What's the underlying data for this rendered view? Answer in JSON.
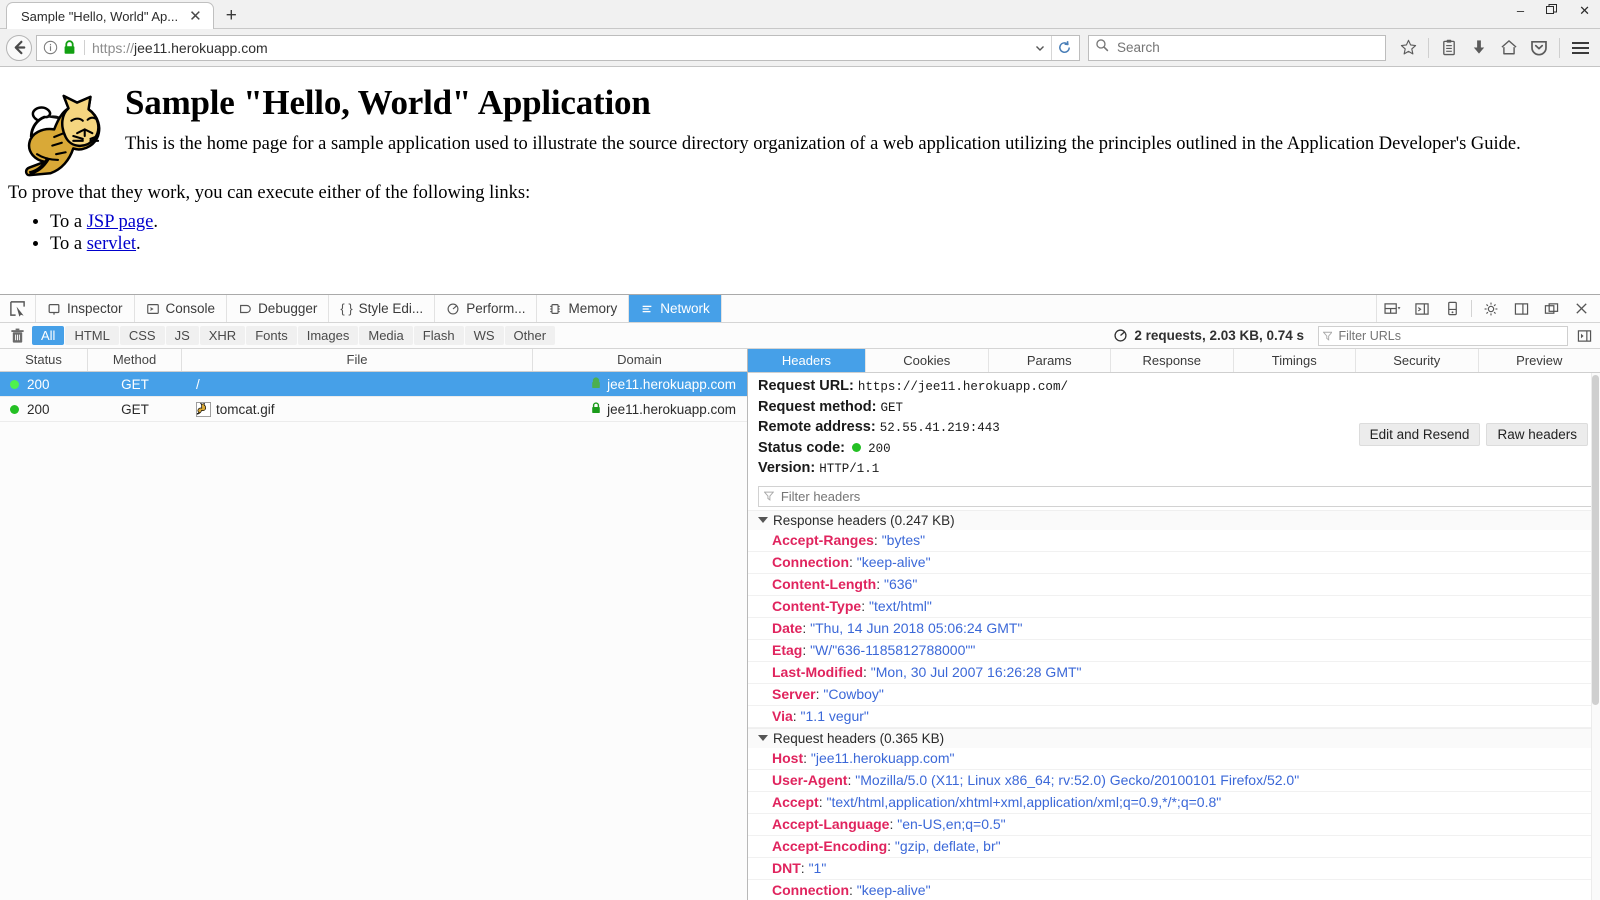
{
  "browser": {
    "tab": {
      "title": "Sample \"Hello, World\" Ap...",
      "close_label": "✕"
    },
    "newtab_label": "+",
    "window_controls": {
      "minimize": "–",
      "maximize": "❐",
      "close": "✕"
    },
    "url": {
      "scheme": "https://",
      "host": "jee11.herokuapp.com"
    },
    "search_placeholder": "Search",
    "icons": {
      "back": "back-arrow-icon",
      "identity": "info-icon",
      "lock": "lock-icon",
      "dropmarker": "chevron-down-icon",
      "reload": "reload-icon",
      "search": "search-icon",
      "bookmark": "star-icon",
      "library": "library-icon",
      "downloads": "download-icon",
      "home": "home-icon",
      "pocket": "pocket-icon",
      "menu": "hamburger-menu-icon"
    }
  },
  "page": {
    "title": "Sample \"Hello, World\" Application",
    "intro": "This is the home page for a sample application used to illustrate the source directory organization of a web application utilizing the principles outlined in the Application Developer's Guide.",
    "prove": "To prove that they work, you can execute either of the following links:",
    "links": [
      {
        "prefix": "To a ",
        "link": "JSP page",
        "suffix": "."
      },
      {
        "prefix": "To a ",
        "link": "servlet",
        "suffix": "."
      }
    ],
    "logo_alt": "tomcat-logo"
  },
  "devtools": {
    "tabs": [
      {
        "label": "Inspector",
        "icon": "inspector-icon",
        "active": false
      },
      {
        "label": "Console",
        "icon": "console-icon",
        "active": false
      },
      {
        "label": "Debugger",
        "icon": "debugger-icon",
        "active": false
      },
      {
        "label": "Style Edi...",
        "icon": "style-editor-icon",
        "active": false
      },
      {
        "label": "Perform...",
        "icon": "performance-icon",
        "active": false
      },
      {
        "label": "Memory",
        "icon": "memory-icon",
        "active": false
      },
      {
        "label": "Network",
        "icon": "network-icon",
        "active": true
      }
    ],
    "right_icons": [
      "split-console-layout-icon",
      "open-console-icon",
      "responsive-design-icon",
      "settings-gear-icon",
      "dock-side-icon",
      "separate-window-icon",
      "close-icon"
    ],
    "filters": [
      {
        "label": "All",
        "active": true
      },
      {
        "label": "HTML",
        "active": false
      },
      {
        "label": "CSS",
        "active": false
      },
      {
        "label": "JS",
        "active": false
      },
      {
        "label": "XHR",
        "active": false
      },
      {
        "label": "Fonts",
        "active": false
      },
      {
        "label": "Images",
        "active": false
      },
      {
        "label": "Media",
        "active": false
      },
      {
        "label": "Flash",
        "active": false
      },
      {
        "label": "WS",
        "active": false
      },
      {
        "label": "Other",
        "active": false
      }
    ],
    "summary": "2 requests, 2.03 KB, 0.74 s",
    "url_filter_placeholder": "Filter URLs",
    "trash_icon": "trash-icon",
    "network_table": {
      "columns": [
        "Status",
        "Method",
        "File",
        "Domain"
      ],
      "rows": [
        {
          "status": "200",
          "method": "GET",
          "file": "/",
          "domain": "jee11.herokuapp.com",
          "selected": true,
          "has_favicon": false
        },
        {
          "status": "200",
          "method": "GET",
          "file": "tomcat.gif",
          "domain": "jee11.herokuapp.com",
          "selected": false,
          "has_favicon": true
        }
      ]
    },
    "detail_tabs": [
      {
        "label": "Headers",
        "active": true
      },
      {
        "label": "Cookies",
        "active": false
      },
      {
        "label": "Params",
        "active": false
      },
      {
        "label": "Response",
        "active": false
      },
      {
        "label": "Timings",
        "active": false
      },
      {
        "label": "Security",
        "active": false
      },
      {
        "label": "Preview",
        "active": false
      }
    ],
    "summary_fields": {
      "request_url_label": "Request URL:",
      "request_url_value": "https://jee11.herokuapp.com/",
      "request_method_label": "Request method:",
      "request_method_value": "GET",
      "remote_address_label": "Remote address:",
      "remote_address_value": "52.55.41.219:443",
      "status_code_label": "Status code:",
      "status_code_value": "200",
      "version_label": "Version:",
      "version_value": "HTTP/1.1"
    },
    "edit_resend_label": "Edit and Resend",
    "raw_headers_label": "Raw headers",
    "header_filter_placeholder": "Filter headers",
    "response_headers_title": "Response headers (0.247 KB)",
    "response_headers": [
      {
        "name": "Accept-Ranges",
        "value": "\"bytes\""
      },
      {
        "name": "Connection",
        "value": "\"keep-alive\""
      },
      {
        "name": "Content-Length",
        "value": "\"636\""
      },
      {
        "name": "Content-Type",
        "value": "\"text/html\""
      },
      {
        "name": "Date",
        "value": "\"Thu, 14 Jun 2018 05:06:24 GMT\""
      },
      {
        "name": "Etag",
        "value": "\"W/\"636-1185812788000\"\""
      },
      {
        "name": "Last-Modified",
        "value": "\"Mon, 30 Jul 2007 16:26:28 GMT\""
      },
      {
        "name": "Server",
        "value": "\"Cowboy\""
      },
      {
        "name": "Via",
        "value": "\"1.1 vegur\""
      }
    ],
    "request_headers_title": "Request headers (0.365 KB)",
    "request_headers": [
      {
        "name": "Host",
        "value": "\"jee11.herokuapp.com\""
      },
      {
        "name": "User-Agent",
        "value": "\"Mozilla/5.0 (X11; Linux x86_64; rv:52.0) Gecko/20100101 Firefox/52.0\""
      },
      {
        "name": "Accept",
        "value": "\"text/html,application/xhtml+xml,application/xml;q=0.9,*/*;q=0.8\""
      },
      {
        "name": "Accept-Language",
        "value": "\"en-US,en;q=0.5\""
      },
      {
        "name": "Accept-Encoding",
        "value": "\"gzip, deflate, br\""
      },
      {
        "name": "DNT",
        "value": "\"1\""
      },
      {
        "name": "Connection",
        "value": "\"keep-alive\""
      }
    ]
  },
  "colors": {
    "accent_blue": "#46a0e8",
    "header_name_red": "#e0245e",
    "header_value_blue": "#3b68d8",
    "status_green": "#24c024",
    "link_blue": "#0000cc"
  }
}
